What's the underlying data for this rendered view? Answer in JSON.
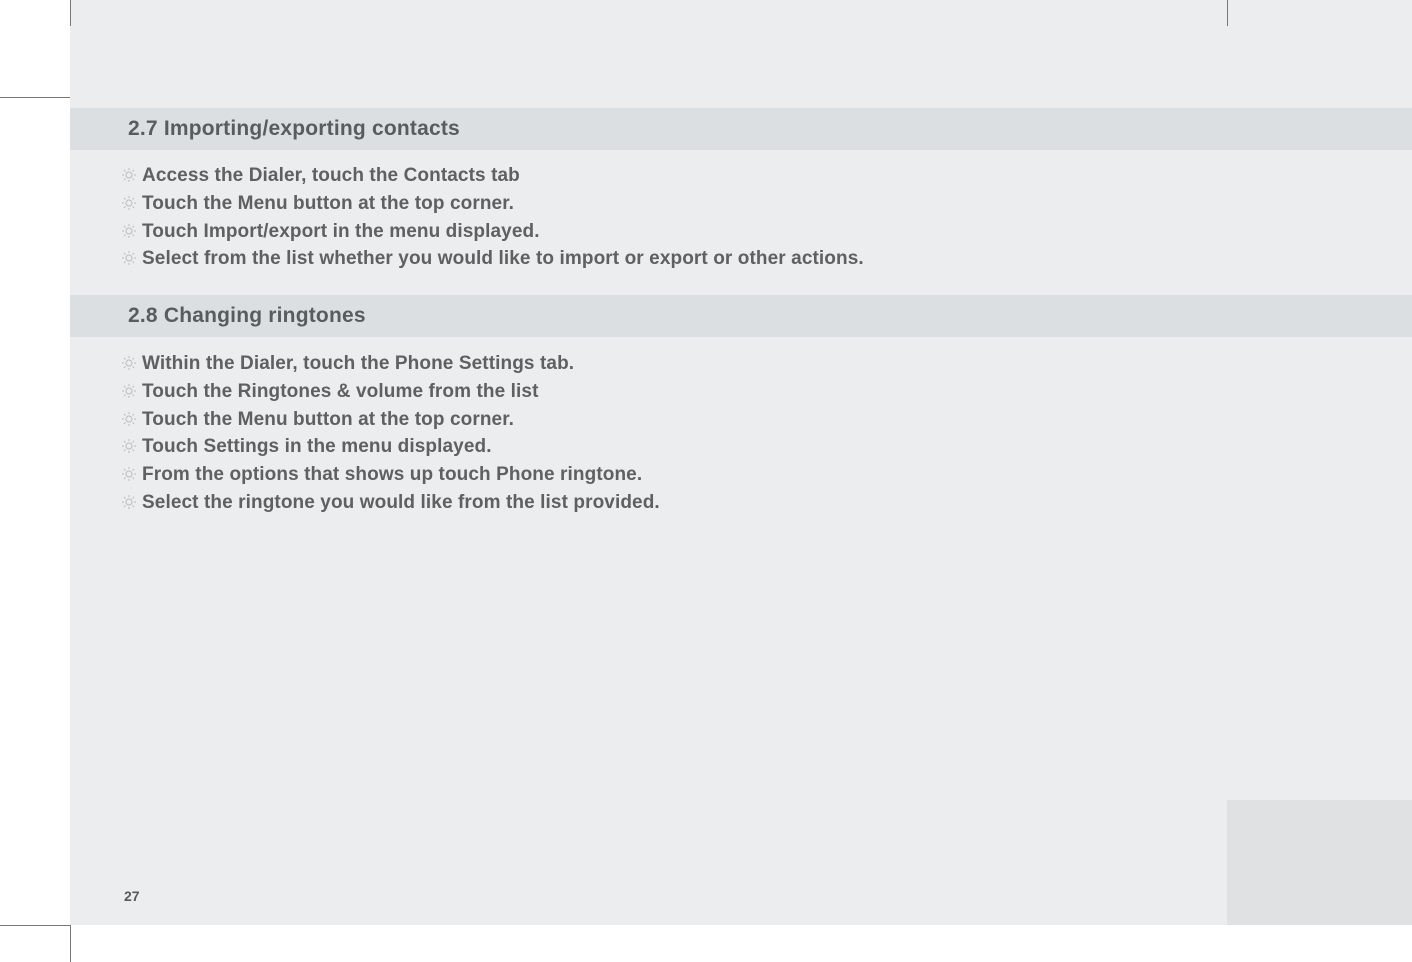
{
  "page_number": "27",
  "sections": [
    {
      "heading": "2.7 Importing/exporting contacts",
      "items": [
        "Access the Dialer, touch the Contacts tab",
        "Touch the Menu button at the top corner.",
        "Touch Import/export in the menu displayed.",
        "Select from the list whether you would like to import or export or other actions."
      ]
    },
    {
      "heading": "2.8 Changing ringtones",
      "items": [
        "Within the Dialer, touch the Phone Settings tab.",
        "Touch the Ringtones & volume from the list",
        "Touch the Menu button at the top corner.",
        "Touch Settings in the menu displayed.",
        "From the options that shows up touch Phone ringtone.",
        "Select the ringtone you would like from the list provided."
      ]
    }
  ]
}
